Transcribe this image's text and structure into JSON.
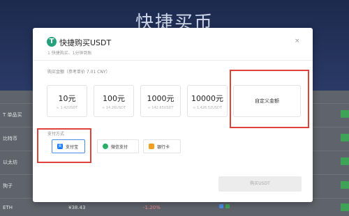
{
  "background": {
    "title": "快捷买币",
    "rows": [
      "T 单品买",
      "比特币",
      "以太坊",
      "狗子",
      "ETH"
    ],
    "price": "¥38.43",
    "change": "-1.20%"
  },
  "modal": {
    "title": "快捷购买USDT",
    "subtitle": "1 快捷购买、1分钟到账",
    "close_icon": "×",
    "amount_label": "购买金额（参考单价 7.01 CNY）",
    "amounts": [
      {
        "value": "10元",
        "sub": "≈ 1.42USDT"
      },
      {
        "value": "100元",
        "sub": "≈ 14.26USDT"
      },
      {
        "value": "1000元",
        "sub": "≈ 142.65USDT"
      },
      {
        "value": "10000元",
        "sub": "≈ 1,426.52USDT"
      }
    ],
    "custom_amount": "自定义金额",
    "payment_label": "支付方式",
    "payments": [
      {
        "label": "支付宝",
        "icon": "alipay-icon"
      },
      {
        "label": "微信支付",
        "icon": "wechat-icon"
      },
      {
        "label": "银行卡",
        "icon": "bank-card-icon"
      }
    ],
    "buy_button": "购买USDT"
  },
  "colors": {
    "highlight": "#e0413a",
    "alipay": "#1677ff",
    "wechat": "#2aae67",
    "bank": "#f0a020",
    "tether": "#26a17b"
  }
}
